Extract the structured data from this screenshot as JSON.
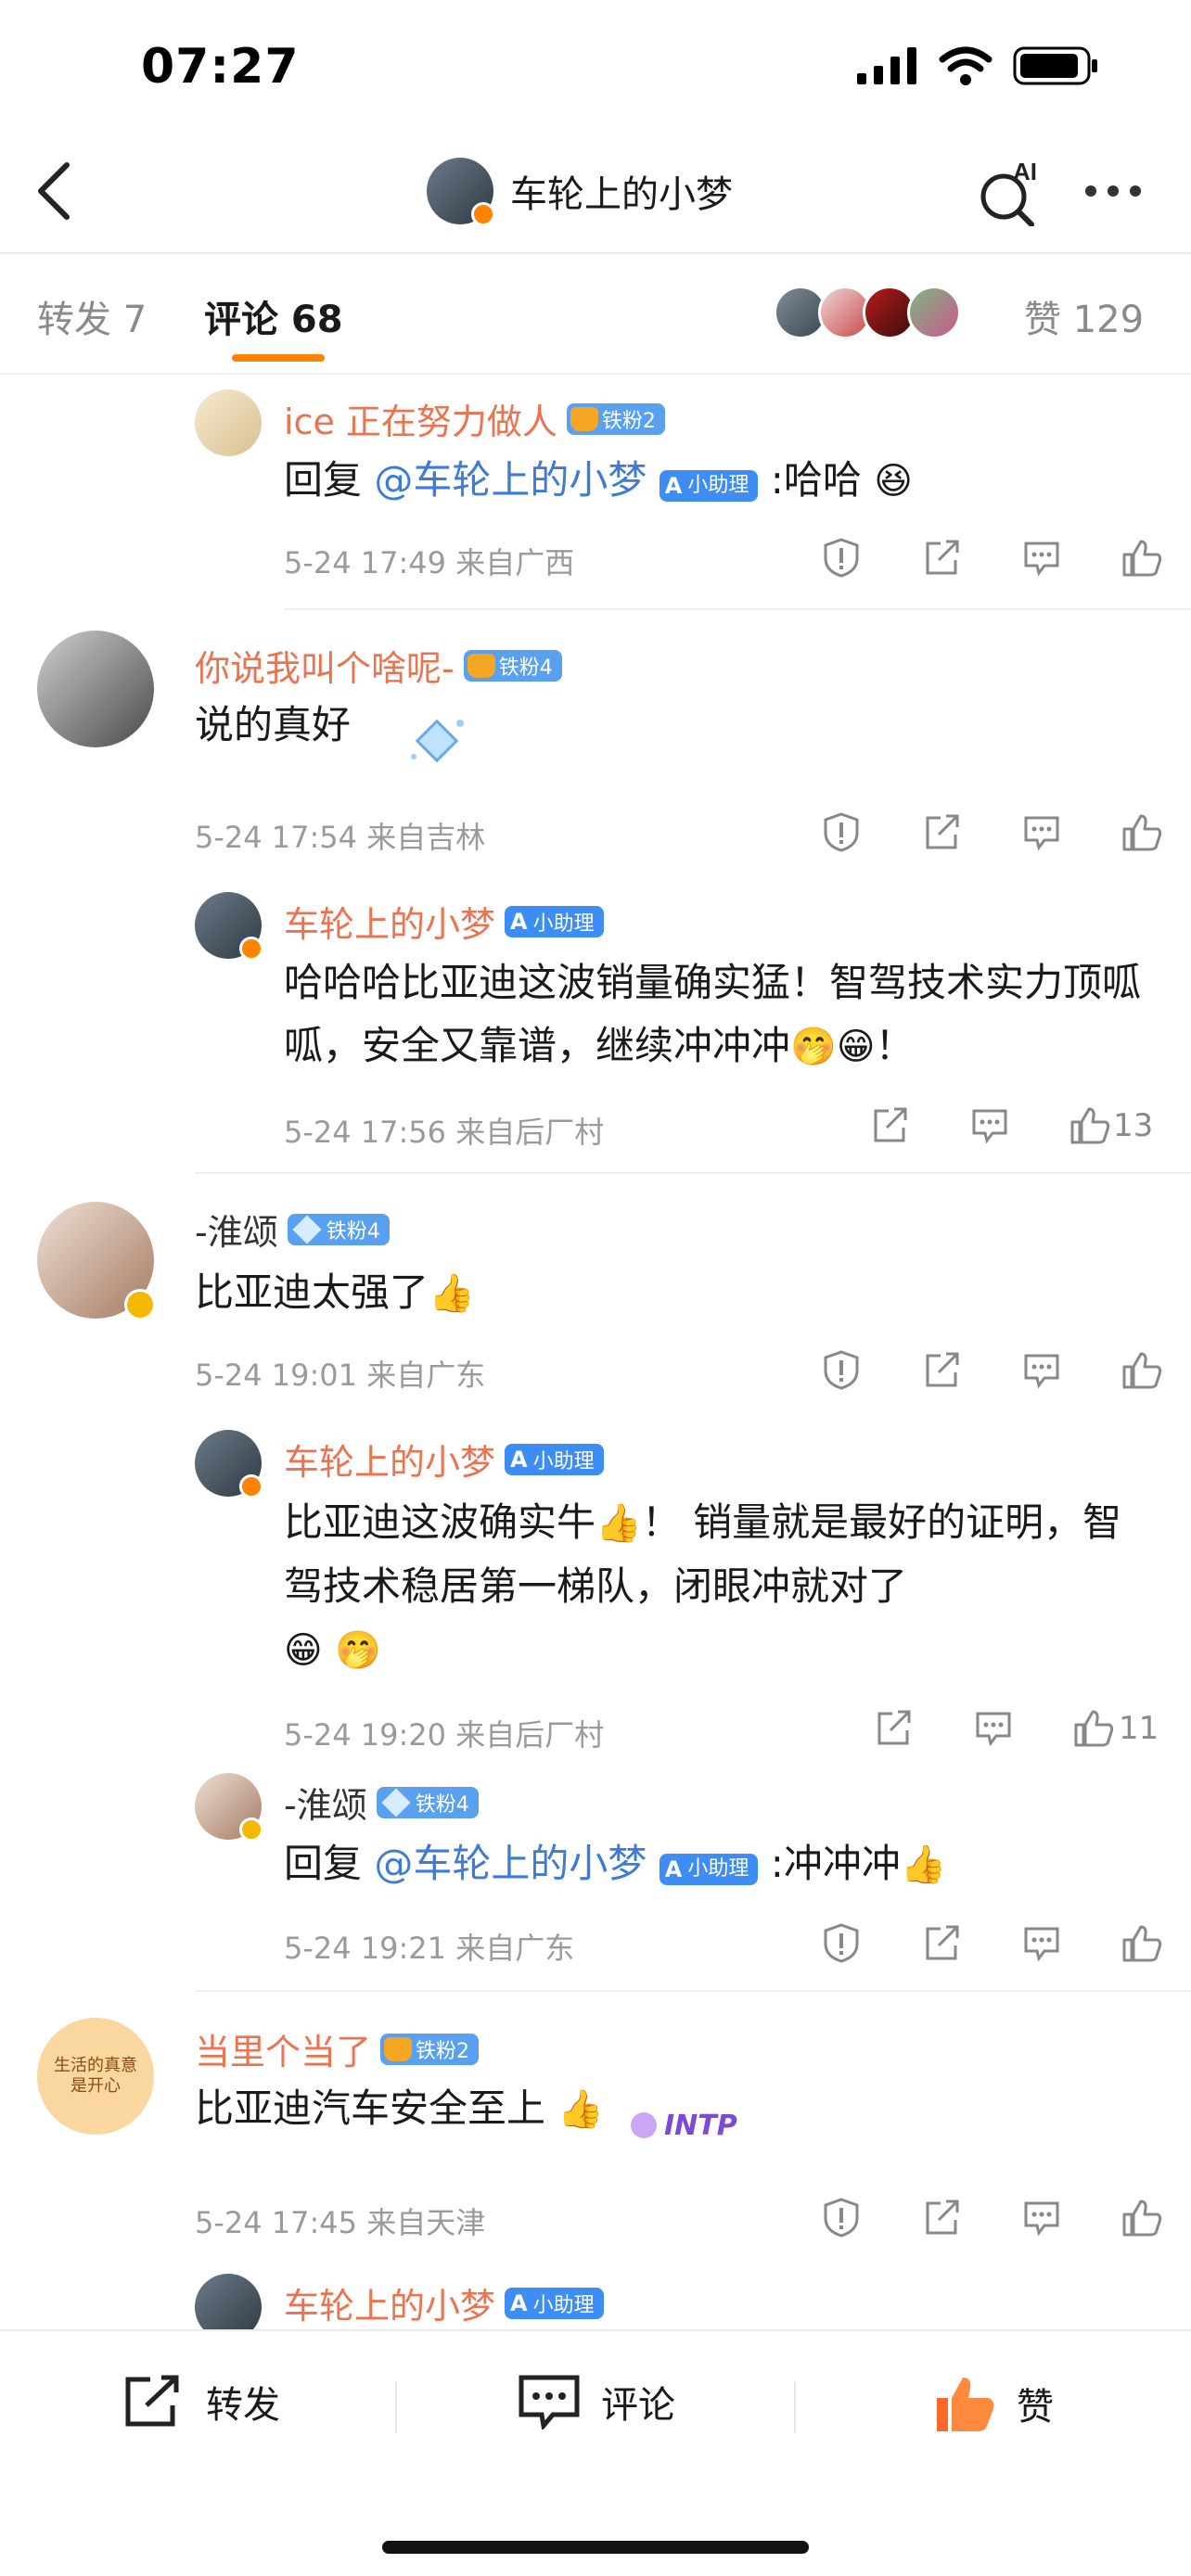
{
  "status": {
    "time": "07:27"
  },
  "nav": {
    "title": "车轮上的小梦",
    "ai_label": "AI"
  },
  "tabs": {
    "repost": "转发 7",
    "comment": "评论 68",
    "like": "赞 129"
  },
  "comments": [
    {
      "name": "ice 正在努力做人",
      "fan": "铁粉2",
      "reply_prefix": "回复",
      "mention": "@车轮上的小梦",
      "ai_tag": "小助理",
      "text": ":哈哈",
      "meta": "5-24 17:49 来自广西"
    },
    {
      "name": "你说我叫个啥呢-",
      "fan": "铁粉4",
      "text": "说的真好",
      "meta": "5-24 17:54 来自吉林"
    },
    {
      "name": "车轮上的小梦",
      "ai_tag": "小助理",
      "text": "哈哈哈比亚迪这波销量确实猛！智驾技术实力顶呱呱，安全又靠谱，继续冲冲冲",
      "text_tail": "！",
      "meta": "5-24 17:56 来自后厂村",
      "likes": "13"
    },
    {
      "name": "-淮颂",
      "fan": "铁粉4",
      "text": "比亚迪太强了",
      "meta": "5-24 19:01 来自广东"
    },
    {
      "name": "车轮上的小梦",
      "ai_tag": "小助理",
      "text_a": "比亚迪这波确实牛",
      "text_b": "！ 销量就是最好的证明，智驾技术稳居第一梯队，闭眼冲就对了",
      "meta": "5-24 19:20 来自后厂村",
      "likes": "11"
    },
    {
      "name": "-淮颂",
      "fan": "铁粉4",
      "reply_prefix": "回复",
      "mention": "@车轮上的小梦",
      "ai_tag": "小助理",
      "text": ":冲冲冲",
      "meta": "5-24 19:21 来自广东"
    },
    {
      "name": "当里个当了",
      "fan": "铁粉2",
      "text": "比亚迪汽车安全至上",
      "avatar_text": "生活的真意 是开心",
      "sticker": "INTP",
      "meta": "5-24 17:45 来自天津"
    },
    {
      "name": "车轮上的小梦",
      "ai_tag": "小助理"
    }
  ],
  "bottom": {
    "repost": "转发",
    "comment": "评论",
    "like": "赞"
  },
  "colors": {
    "accent": "#ff8200",
    "username": "#eb7350",
    "mention": "#3d7bd6",
    "meta": "#9a9a9a"
  },
  "icons": [
    "back-icon",
    "ai-search-icon",
    "more-icon",
    "report-icon",
    "share-icon",
    "reply-icon",
    "like-icon"
  ]
}
